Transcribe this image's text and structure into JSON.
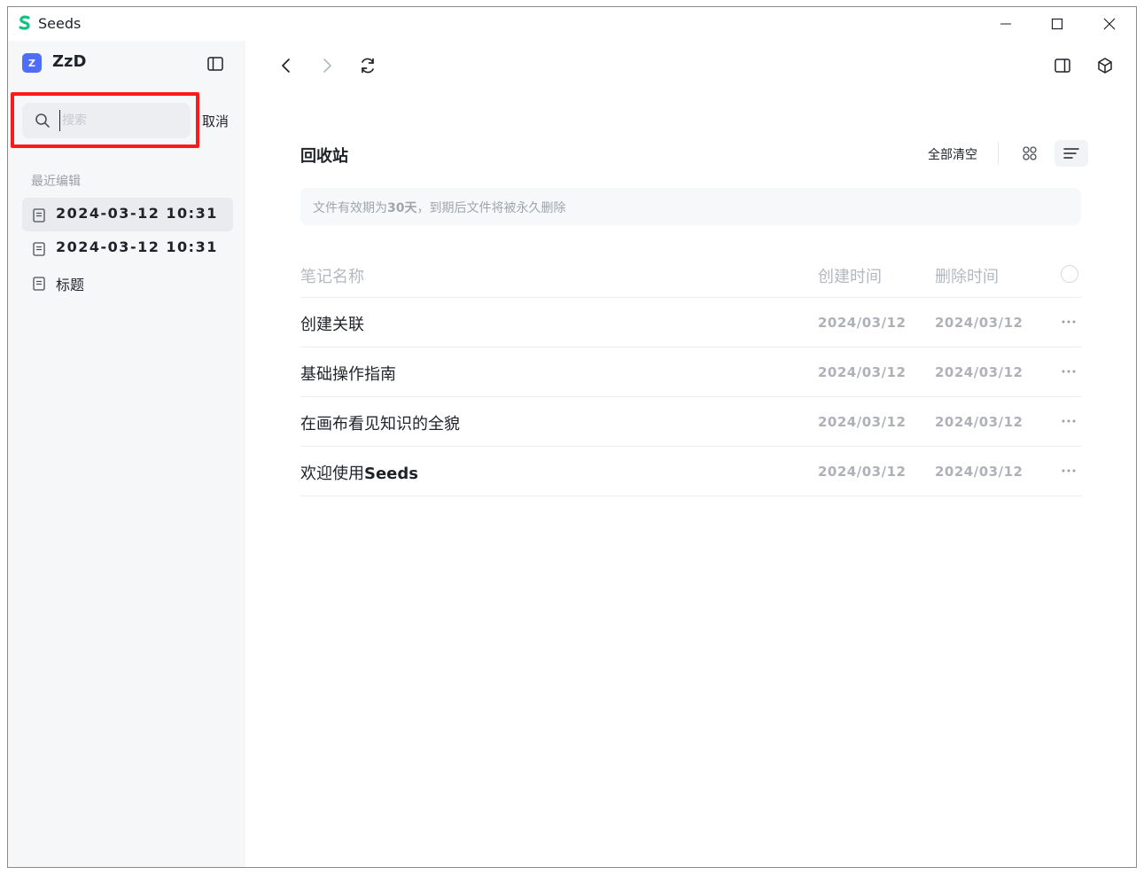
{
  "window": {
    "app_title": "Seeds",
    "brand_color": "#10c27f"
  },
  "sidebar": {
    "workspace_initial": "Z",
    "workspace_name": "ZzD",
    "search": {
      "placeholder": "搜索",
      "value": ""
    },
    "cancel_label": "取消",
    "section_label": "最近编辑",
    "recent_items": [
      {
        "label": "2024-03-12 10:31",
        "active": true
      },
      {
        "label": "2024-03-12 10:31",
        "active": false
      },
      {
        "label": "标题",
        "active": false
      }
    ]
  },
  "main": {
    "title": "回收站",
    "clear_all_label": "全部清空",
    "notice": {
      "prefix": "文件有效期为",
      "days": "30天",
      "suffix": "，到期后文件将被永久删除"
    },
    "table": {
      "headers": {
        "name": "笔记名称",
        "created": "创建时间",
        "deleted": "删除时间"
      },
      "rows": [
        {
          "name": "创建关联",
          "name_bold": "",
          "created": "2024/03/12",
          "deleted": "2024/03/12"
        },
        {
          "name": "基础操作指南",
          "name_bold": "",
          "created": "2024/03/12",
          "deleted": "2024/03/12"
        },
        {
          "name": "在画布看见知识的全貌",
          "name_bold": "",
          "created": "2024/03/12",
          "deleted": "2024/03/12"
        },
        {
          "name": "欢迎使用",
          "name_bold": "Seeds",
          "created": "2024/03/12",
          "deleted": "2024/03/12"
        }
      ]
    }
  },
  "icons": {
    "titlebar": [
      "minimize-icon",
      "maximize-icon",
      "close-icon"
    ],
    "nav": [
      "back-arrow-icon",
      "forward-arrow-icon",
      "refresh-icon"
    ],
    "top_right": [
      "panel-toggle-icon",
      "cube-icon"
    ],
    "view": [
      "grid-view-icon",
      "list-view-icon"
    ],
    "row_action": "more-icon"
  },
  "colors": {
    "accent": "#4f6ef7",
    "highlight": "#ff1a1a",
    "sidebar_bg": "#f6f7f9"
  }
}
